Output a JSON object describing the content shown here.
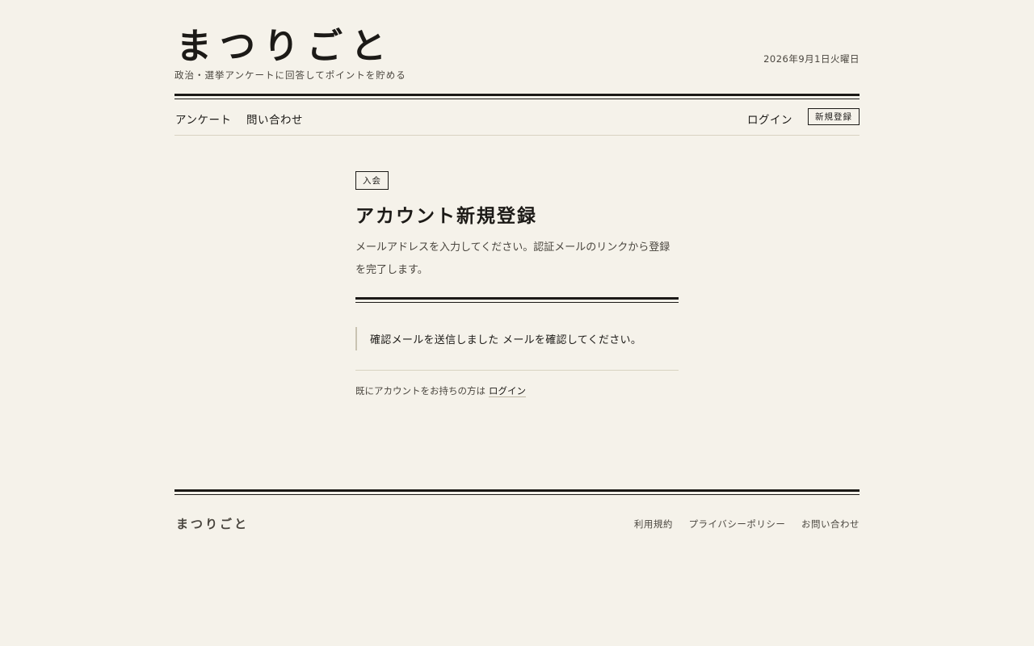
{
  "header": {
    "logo": "まつりごと",
    "tagline": "政治・選挙アンケートに回答してポイントを貯める",
    "date": "2026年9月1日火曜日"
  },
  "nav": {
    "left": [
      {
        "label": "アンケート"
      },
      {
        "label": "問い合わせ"
      }
    ],
    "login": "ログイン",
    "signup": "新規登録"
  },
  "main": {
    "badge": "入会",
    "title": "アカウント新規登録",
    "description": "メールアドレスを入力してください。認証メールのリンクから登録を完了します。",
    "notice": "確認メールを送信しました メールを確認してください。",
    "already_text": "既にアカウントをお持ちの方は",
    "login_link": "ログイン"
  },
  "footer": {
    "logo": "まつりごと",
    "links": [
      "利用規約",
      "プライバシーポリシー",
      "お問い合わせ"
    ]
  }
}
